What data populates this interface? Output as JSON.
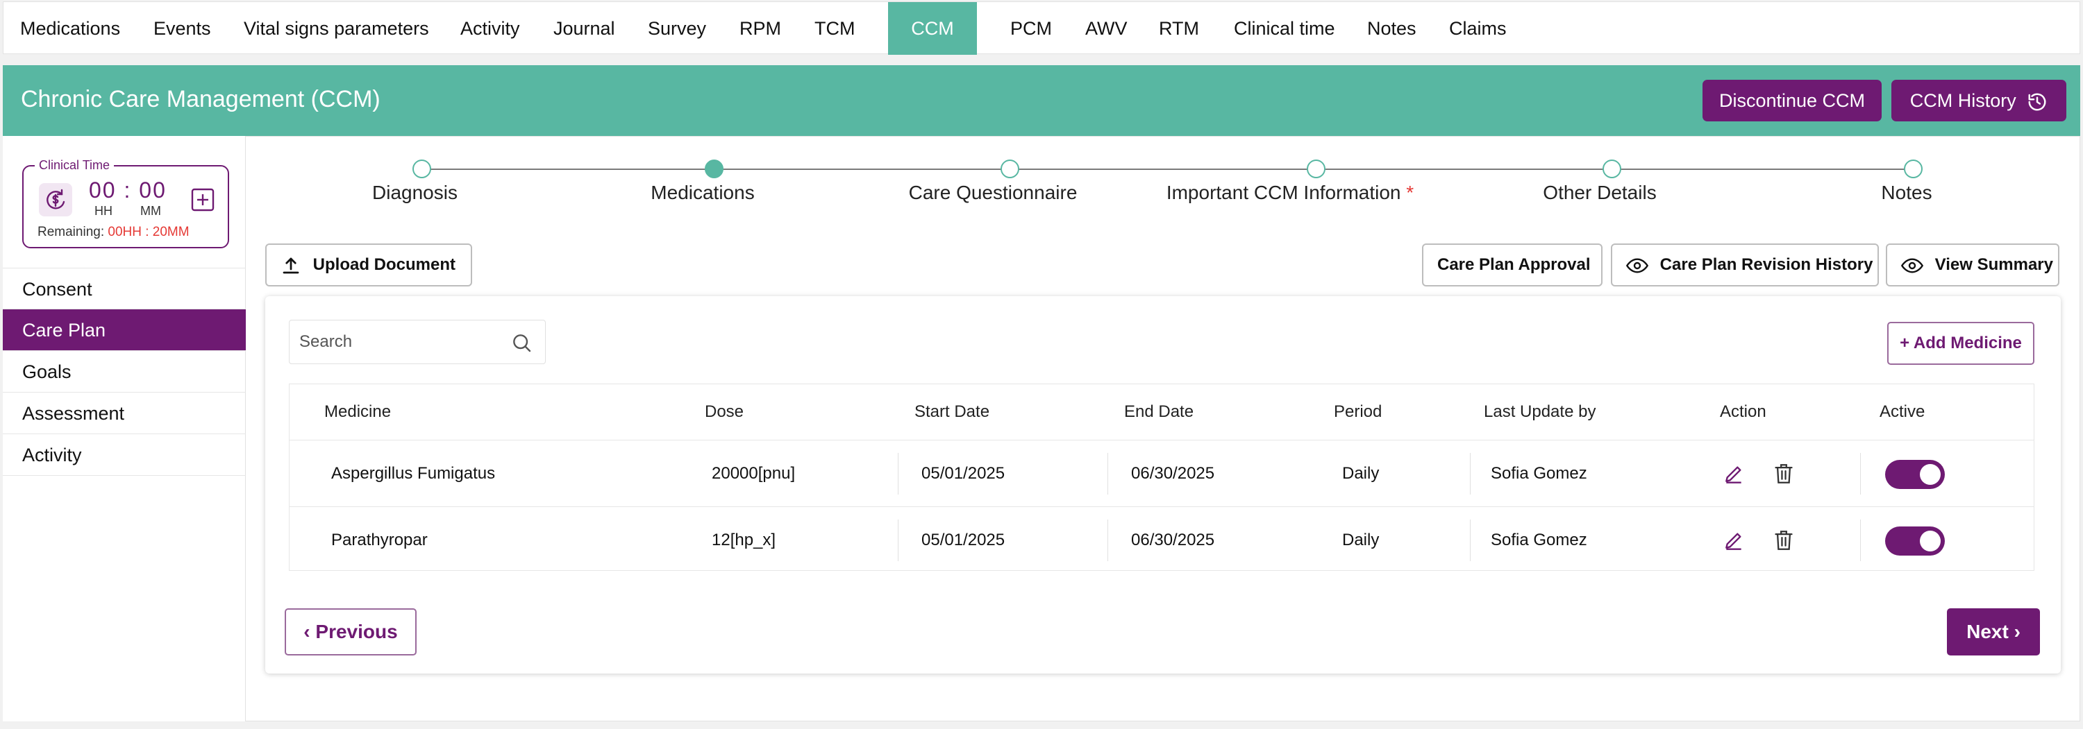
{
  "nav": {
    "tabs": [
      "Medications",
      "Events",
      "Vital signs parameters",
      "Activity",
      "Journal",
      "Survey",
      "RPM",
      "TCM",
      "CCM",
      "PCM",
      "AWV",
      "RTM",
      "Clinical time",
      "Notes",
      "Claims"
    ],
    "active": "CCM"
  },
  "header": {
    "title": "Chronic Care Management (CCM)",
    "discontinue_label": "Discontinue CCM",
    "history_label": "CCM History"
  },
  "clinical_time": {
    "legend": "Clinical Time",
    "hours": "00",
    "minutes": "00",
    "hh_label": "HH",
    "mm_label": "MM",
    "remaining_label": "Remaining:",
    "remaining_value": "00HH : 20MM"
  },
  "sidebar": {
    "items": [
      "Consent",
      "Care Plan",
      "Goals",
      "Assessment",
      "Activity"
    ],
    "active": "Care Plan"
  },
  "stepper": {
    "steps": [
      "Diagnosis",
      "Medications",
      "Care Questionnaire",
      "Important CCM Information",
      "Other Details",
      "Notes"
    ],
    "current": "Medications",
    "required_marker": "*"
  },
  "toolbar": {
    "upload_label": "Upload Document",
    "approval_label": "Care Plan Approval",
    "revision_label": "Care Plan Revision History",
    "summary_label": "View Summary"
  },
  "card": {
    "search_placeholder": "Search",
    "add_label": "+ Add Medicine"
  },
  "table": {
    "headers": [
      "Medicine",
      "Dose",
      "Start Date",
      "End Date",
      "Period",
      "Last Update by",
      "Action",
      "Active"
    ],
    "rows": [
      {
        "medicine": "Aspergillus Fumigatus",
        "dose": "20000[pnu]",
        "start": "05/01/2025",
        "end": "06/30/2025",
        "period": "Daily",
        "updated_by": "Sofia Gomez",
        "active": true
      },
      {
        "medicine": "Parathyropar",
        "dose": "12[hp_x]",
        "start": "05/01/2025",
        "end": "06/30/2025",
        "period": "Daily",
        "updated_by": "Sofia Gomez",
        "active": true
      }
    ]
  },
  "pager": {
    "prev_label": "Previous",
    "next_label": "Next"
  },
  "colors": {
    "teal": "#58b7a2",
    "purple": "#6e1a72",
    "required_red": "#e53935"
  }
}
